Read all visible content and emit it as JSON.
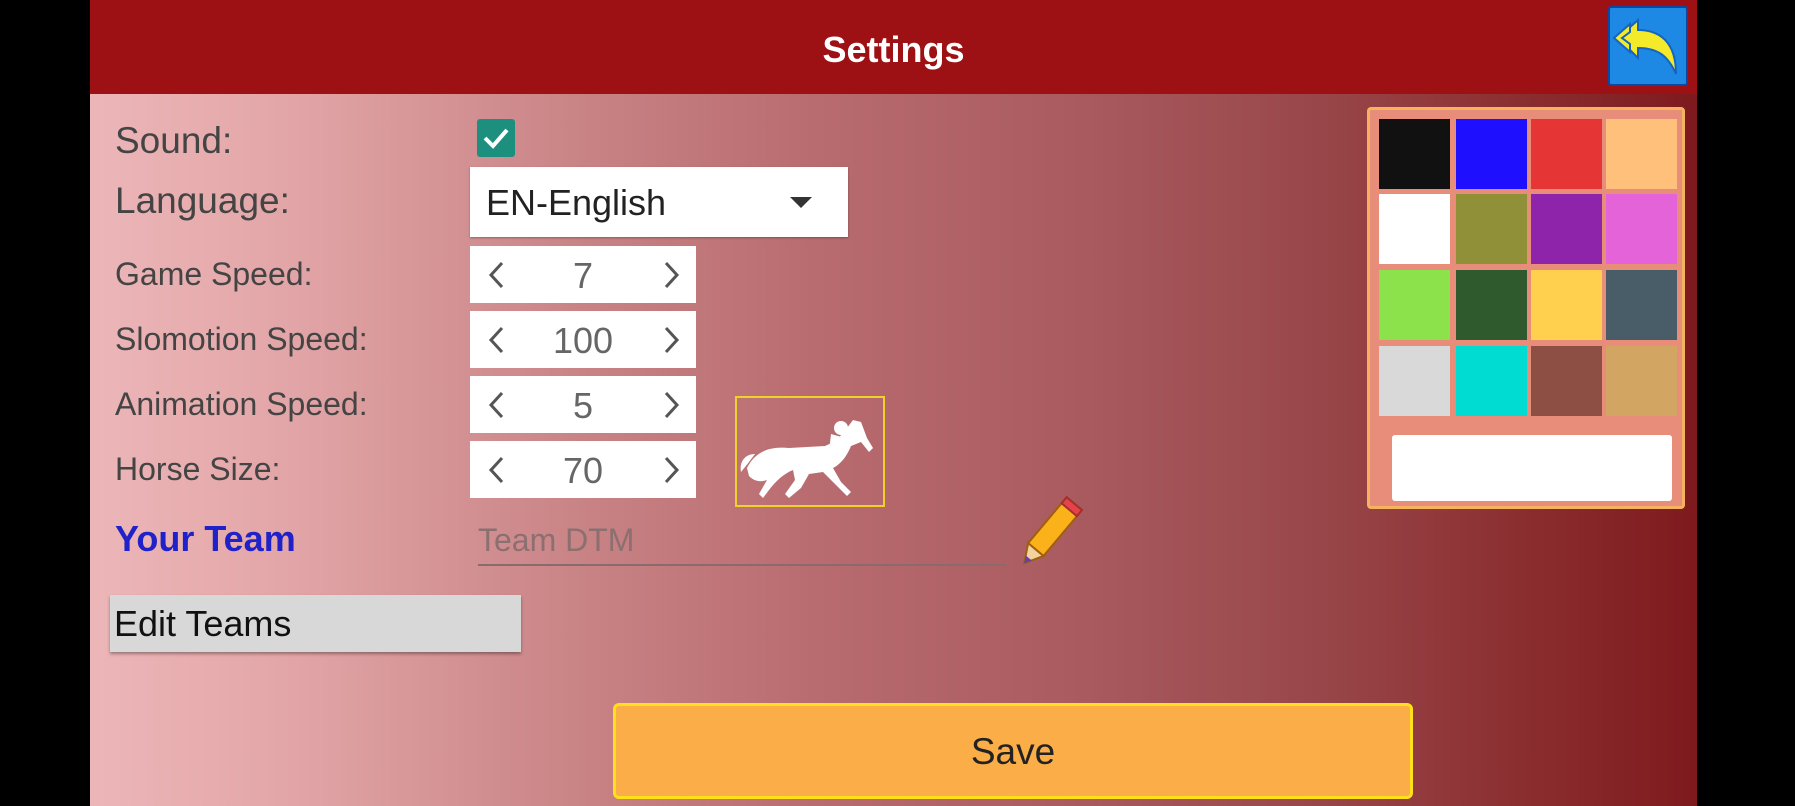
{
  "header": {
    "title": "Settings"
  },
  "settings": {
    "sound_label": "Sound:",
    "sound_checked": true,
    "language_label": "Language:",
    "language_value": "EN-English",
    "game_speed_label": "Game Speed:",
    "game_speed_value": "7",
    "slomotion_speed_label": "Slomotion Speed:",
    "slomotion_speed_value": "100",
    "animation_speed_label": "Animation Speed:",
    "animation_speed_value": "5",
    "horse_size_label": "Horse Size:",
    "horse_size_value": "70"
  },
  "team": {
    "label": "Your Team",
    "value": "Team DTM",
    "edit_label": "Edit Teams"
  },
  "palette": {
    "colors": [
      "#111111",
      "#1e0fff",
      "#e53535",
      "#ffc07c",
      "#ffffff",
      "#909039",
      "#8e24aa",
      "#e563d8",
      "#8ce24b",
      "#2e5a2e",
      "#ffd04d",
      "#485d67",
      "#d9d9d9",
      "#00dcd2",
      "#8d4f43",
      "#d2a562"
    ],
    "hex_value": ""
  },
  "save_label": "Save",
  "icons": {
    "back": "back-arrow-icon",
    "dropdown": "chevron-down-icon",
    "edit": "pencil-icon",
    "horse": "horse-rider-icon"
  }
}
